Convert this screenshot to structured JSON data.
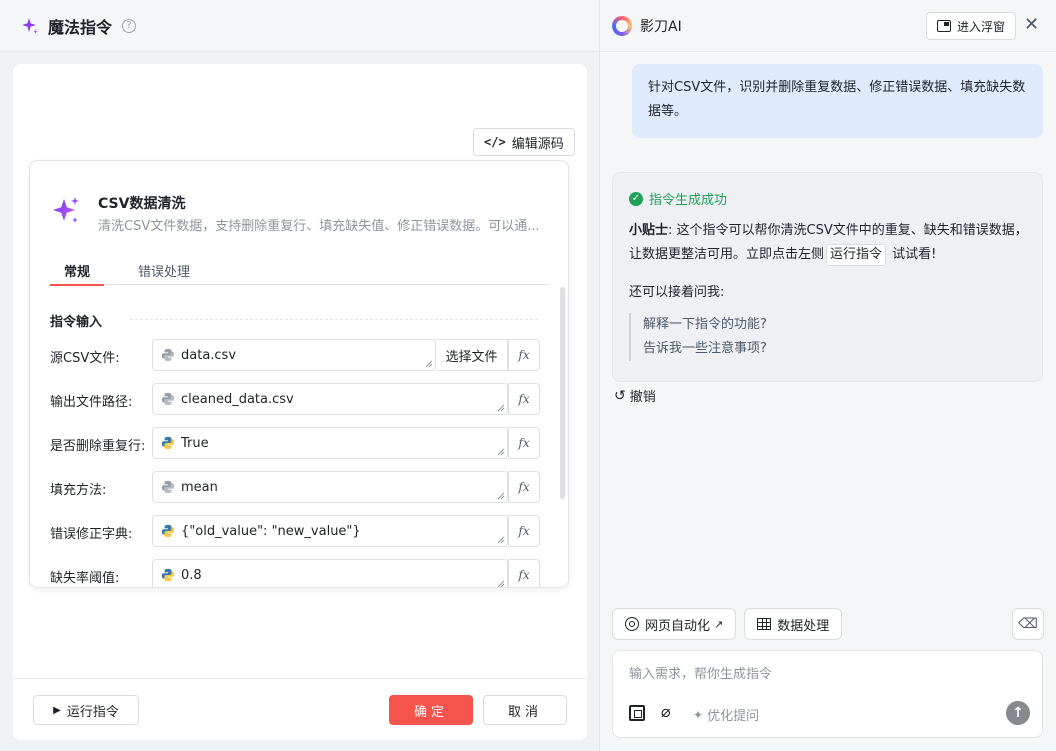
{
  "left": {
    "title": "魔法指令",
    "help": "?",
    "edit_source": "编辑源码",
    "card": {
      "title": "CSV数据清洗",
      "description": "清洗CSV文件数据，支持删除重复行、填充缺失值、修正错误数据。可以通...",
      "tabs": [
        "常规",
        "错误处理"
      ],
      "section_title": "指令输入",
      "fields": [
        {
          "label": "源CSV文件:",
          "value": "data.csv",
          "icon": "python-gray-icon",
          "extra_button": "选择文件"
        },
        {
          "label": "输出文件路径:",
          "value": "cleaned_data.csv",
          "icon": "python-gray-icon"
        },
        {
          "label": "是否删除重复行:",
          "value": "True",
          "icon": "python-color-icon"
        },
        {
          "label": "填充方法:",
          "value": "mean",
          "icon": "python-gray-icon"
        },
        {
          "label": "错误修正字典:",
          "value": "{\"old_value\": \"new_value\"}",
          "icon": "python-color-icon"
        },
        {
          "label": "缺失率阈值:",
          "value": "0.8",
          "icon": "python-color-icon"
        }
      ],
      "fx": "fx"
    },
    "footer": {
      "run": "运行指令",
      "confirm": "确定",
      "cancel": "取消"
    }
  },
  "right": {
    "app_name": "影刀AI",
    "float_window": "进入浮窗",
    "user_message": "针对CSV文件，识别并删除重复数据、修正错误数据、填充缺失数据等。",
    "ai": {
      "status": "指令生成成功",
      "tip_label": "小贴士",
      "tip_text_1": ": 这个指令可以帮你清洗CSV文件中的重复、缺失和错误数据，让数据更整洁可用。立即点击左侧",
      "tip_chip": "运行指令",
      "tip_text_2": "试试看!",
      "also_ask": "还可以接着问我:",
      "suggestions": [
        "解释一下指令的功能?",
        "告诉我一些注意事项?"
      ]
    },
    "undo": "撤销",
    "quick_actions": [
      "网页自动化",
      "数据处理"
    ],
    "input_placeholder": "输入需求，帮你生成指令",
    "optimize": "优化提问"
  },
  "colors": {
    "accent_red": "#f5544d",
    "success_green": "#20a05a",
    "user_bubble": "#dfeafd"
  }
}
